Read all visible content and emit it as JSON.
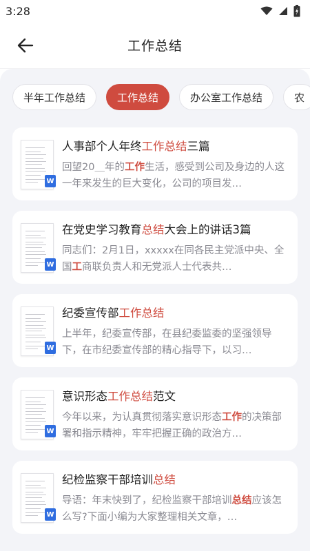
{
  "status_bar": {
    "time": "3:28"
  },
  "header": {
    "title": "工作总结",
    "back_icon": "arrow-left-icon"
  },
  "tabs": [
    {
      "label": "半年工作总结",
      "active": false
    },
    {
      "label": "工作总结",
      "active": true
    },
    {
      "label": "办公室工作总结",
      "active": false
    },
    {
      "label": "农",
      "active": false
    }
  ],
  "colors": {
    "accent": "#cf4b3f",
    "doc_badge": "#2f6de0",
    "background": "#f3f4f8"
  },
  "articles": [
    {
      "title": [
        {
          "t": "人事部个人年终"
        },
        {
          "t": "工作总结",
          "hl": true
        },
        {
          "t": "三篇"
        }
      ],
      "summary": [
        {
          "t": "回望20＿年的"
        },
        {
          "t": "工作",
          "hl": true,
          "bold": true
        },
        {
          "t": "生活，感受到公司及身边的人这一年来发生的巨大变化，公司的项目发…"
        }
      ]
    },
    {
      "title": [
        {
          "t": "在党史学习教育"
        },
        {
          "t": "总结",
          "hl": true
        },
        {
          "t": "大会上的讲话3篇"
        }
      ],
      "summary": [
        {
          "t": "同志们：2月1日，xxxxx在同各民主党派中央、全国"
        },
        {
          "t": "工",
          "hl": true,
          "bold": true
        },
        {
          "t": "商联负责人和无党派人士代表共…"
        }
      ]
    },
    {
      "title": [
        {
          "t": "纪委宣传部"
        },
        {
          "t": "工作总结",
          "hl": true
        }
      ],
      "summary": [
        {
          "t": "上半年，纪委宣传部，在县纪委监委的坚强领导下，在市纪委宣传部的精心指导下，以习…"
        }
      ]
    },
    {
      "title": [
        {
          "t": "意识形态"
        },
        {
          "t": "工作总结",
          "hl": true
        },
        {
          "t": "范文"
        }
      ],
      "summary": [
        {
          "t": "今年以来，为认真贯彻落实意识形态"
        },
        {
          "t": "工作",
          "hl": true,
          "bold": true
        },
        {
          "t": "的决策部署和指示精神，牢牢把握正确的政治方…"
        }
      ]
    },
    {
      "title": [
        {
          "t": "纪检监察干部培训"
        },
        {
          "t": "总结",
          "hl": true
        }
      ],
      "summary": [
        {
          "t": "导语：年末快到了，纪检监察干部培训"
        },
        {
          "t": "总结",
          "hl": true,
          "bold": true
        },
        {
          "t": "应该怎么写?下面小编为大家整理相关文章，…"
        }
      ]
    }
  ],
  "doc_badge_label": "W",
  "doc_icon": "word-document-icon"
}
